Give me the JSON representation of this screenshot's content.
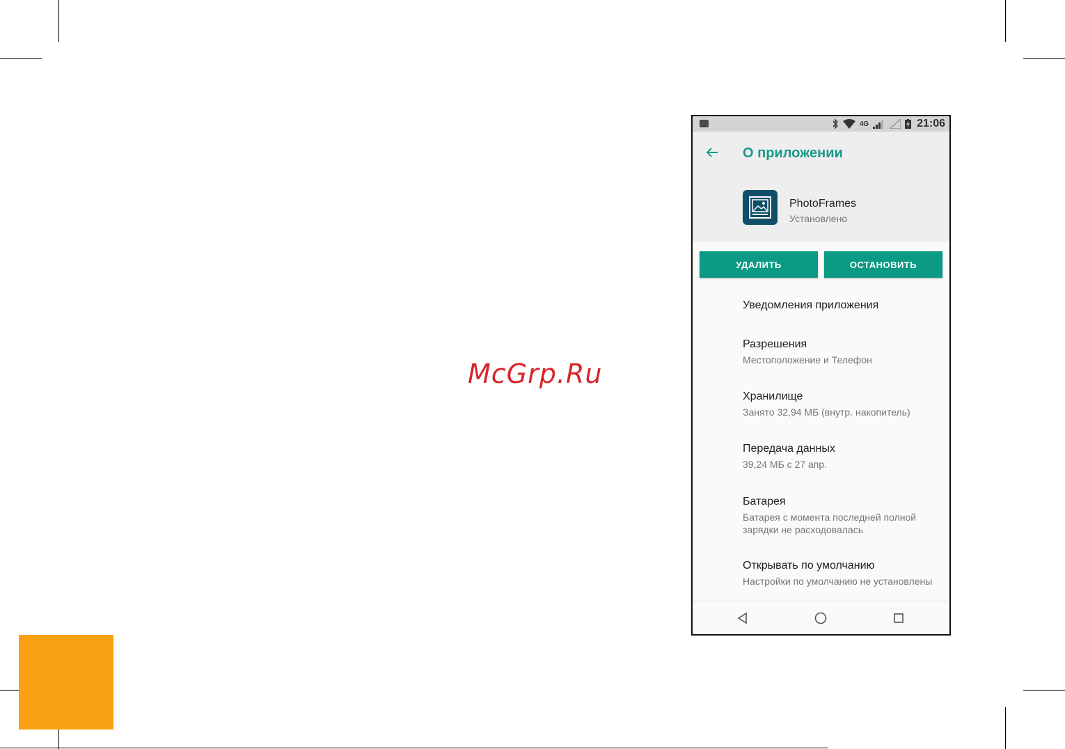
{
  "watermark": "McGrp.Ru",
  "status_bar": {
    "time": "21:06",
    "network": "4G",
    "icons": [
      "gallery-icon",
      "bluetooth-icon",
      "wifi-icon",
      "signal-icon",
      "no-sim-icon",
      "battery-icon"
    ]
  },
  "header": {
    "title": "О приложении",
    "app_name": "PhotoFrames",
    "app_status": "Установлено"
  },
  "buttons": {
    "uninstall": "УДАЛИТЬ",
    "force_stop": "ОСТАНОВИТЬ"
  },
  "settings": [
    {
      "title": "Уведомления приложения",
      "subtitle": ""
    },
    {
      "title": "Разрешения",
      "subtitle": "Местоположение и Телефон"
    },
    {
      "title": "Хранилище",
      "subtitle": "Занято 32,94 МБ (внутр. накопитель)"
    },
    {
      "title": "Передача данных",
      "subtitle": "39,24 МБ с 27 апр."
    },
    {
      "title": "Батарея",
      "subtitle": "Батарея с момента последней полной зарядки не расходовалась"
    },
    {
      "title": "Открывать по умолчанию",
      "subtitle": "Настройки по умолчанию не установлены"
    }
  ],
  "colors": {
    "accent": "#0b9a84",
    "title": "#1a9a8a",
    "orange_block": "#f9a013",
    "watermark": "#d7262b"
  }
}
